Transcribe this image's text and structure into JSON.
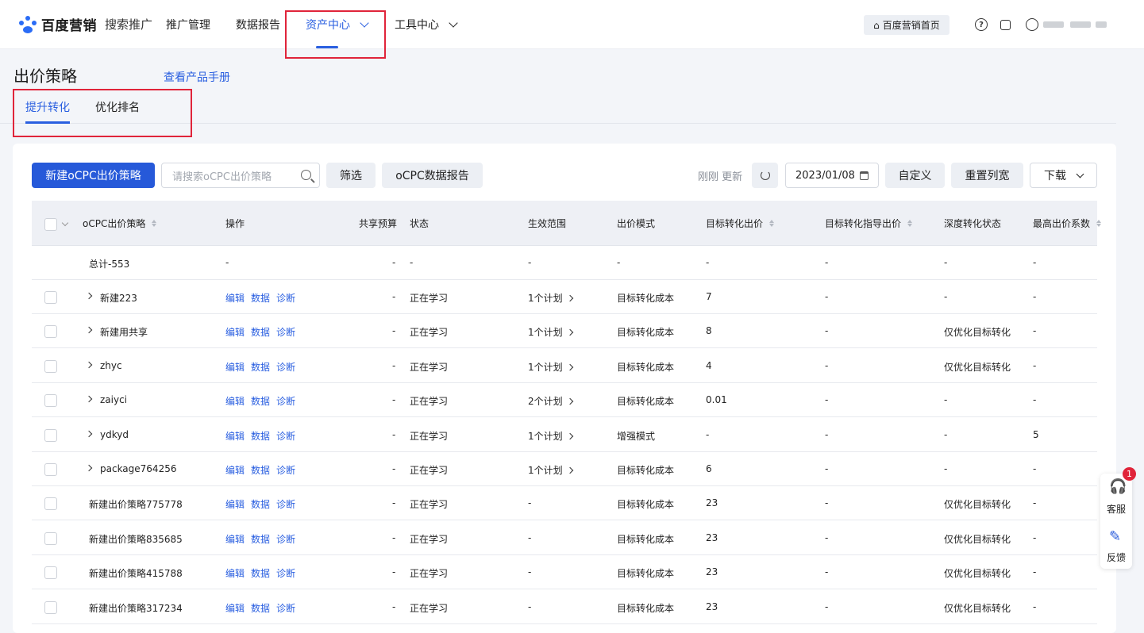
{
  "topbar": {
    "brand": "百度营销",
    "product": "搜索推广",
    "nav": [
      "推广管理",
      "数据报告",
      "资产中心",
      "工具中心"
    ],
    "home_label": "百度营销首页"
  },
  "page": {
    "title": "出价策略",
    "manual_link": "查看产品手册",
    "tabs": [
      "提升转化",
      "优化排名"
    ]
  },
  "toolbar": {
    "new_button": "新建oCPC出价策略",
    "search_placeholder": "请搜索oCPC出价策略",
    "filter_button": "筛选",
    "report_button": "oCPC数据报告",
    "updated_text": "刚刚 更新",
    "date_value": "2023/01/08",
    "custom_button": "自定义",
    "reset_button": "重置列宽",
    "download_button": "下载"
  },
  "table": {
    "headers": [
      "oCPC出价策略",
      "操作",
      "共享预算",
      "状态",
      "生效范围",
      "出价模式",
      "目标转化出价",
      "目标转化指导出价",
      "深度转化状态",
      "最高出价系数"
    ],
    "total": {
      "name": "总计-553",
      "op": "-",
      "budget": "-",
      "status": "-",
      "scope": "-",
      "mode": "-",
      "bid": "-",
      "guide": "-",
      "deep": "-",
      "coef": "-"
    },
    "actions": [
      "编辑",
      "数据",
      "诊断"
    ],
    "rows": [
      {
        "name": "新建223",
        "budget": "-",
        "status": "正在学习",
        "scope": "1个计划",
        "mode": "目标转化成本",
        "bid": "7",
        "guide": "-",
        "deep": "-",
        "coef": "-"
      },
      {
        "name": "新建用共享",
        "budget": "-",
        "status": "正在学习",
        "scope": "1个计划",
        "mode": "目标转化成本",
        "bid": "8",
        "guide": "-",
        "deep": "仅优化目标转化",
        "coef": "-"
      },
      {
        "name": "zhyc",
        "budget": "-",
        "status": "正在学习",
        "scope": "1个计划",
        "mode": "目标转化成本",
        "bid": "4",
        "guide": "-",
        "deep": "仅优化目标转化",
        "coef": "-"
      },
      {
        "name": "zaiyci",
        "budget": "-",
        "status": "正在学习",
        "scope": "2个计划",
        "mode": "目标转化成本",
        "bid": "0.01",
        "guide": "-",
        "deep": "-",
        "coef": "-"
      },
      {
        "name": "ydkyd",
        "budget": "-",
        "status": "正在学习",
        "scope": "1个计划",
        "mode": "增强模式",
        "bid": "-",
        "guide": "-",
        "deep": "-",
        "coef": "5"
      },
      {
        "name": "package764256",
        "budget": "-",
        "status": "正在学习",
        "scope": "1个计划",
        "mode": "目标转化成本",
        "bid": "6",
        "guide": "-",
        "deep": "-",
        "coef": "-"
      },
      {
        "name": "新建出价策略775778",
        "budget": "-",
        "status": "正在学习",
        "scope": "-",
        "mode": "目标转化成本",
        "bid": "23",
        "guide": "-",
        "deep": "仅优化目标转化",
        "coef": "-"
      },
      {
        "name": "新建出价策略835685",
        "budget": "-",
        "status": "正在学习",
        "scope": "-",
        "mode": "目标转化成本",
        "bid": "23",
        "guide": "-",
        "deep": "仅优化目标转化",
        "coef": "-"
      },
      {
        "name": "新建出价策略415788",
        "budget": "-",
        "status": "正在学习",
        "scope": "-",
        "mode": "目标转化成本",
        "bid": "23",
        "guide": "-",
        "deep": "仅优化目标转化",
        "coef": "-"
      },
      {
        "name": "新建出价策略317234",
        "budget": "-",
        "status": "正在学习",
        "scope": "-",
        "mode": "目标转化成本",
        "bid": "23",
        "guide": "-",
        "deep": "仅优化目标转化",
        "coef": "-"
      }
    ]
  },
  "float_widget": {
    "badge": "1",
    "service_label": "客服",
    "feedback_label": "反馈"
  },
  "colors": {
    "accent": "#2a5fe0",
    "primary_button": "#2659d9",
    "highlight_box": "#e0243a"
  }
}
